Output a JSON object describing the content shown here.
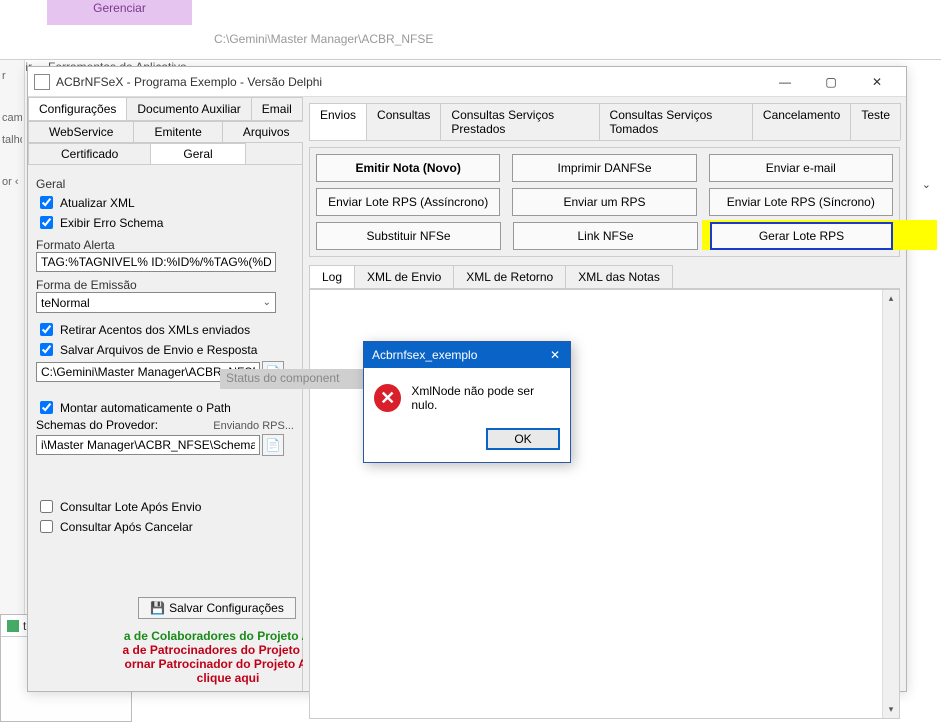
{
  "parent": {
    "tab": "Gerenciar",
    "path": "C:\\Gemini\\Master Manager\\ACBR_NFSE",
    "menu_exibir": "Exibir",
    "menu_ferr": "Ferramentas de Aplicativo"
  },
  "left_strip": {
    "i0": "r",
    "i1": "cami",
    "i2": "talho",
    "i3": "or   ‹"
  },
  "taskbar": {
    "label": "ter Manager\\AC..."
  },
  "window": {
    "title": "ACBrNFSeX - Programa Exemplo - Versão Delphi",
    "min": "—",
    "max": "▢",
    "close": "✕"
  },
  "left_tabs": {
    "t0": "Configurações",
    "t1": "Documento Auxiliar",
    "t2": "Email"
  },
  "left_sub": {
    "t0": "WebService",
    "t1": "Emitente",
    "t2": "Arquivos"
  },
  "left_sub2": {
    "t0": "Certificado",
    "t1": "Geral"
  },
  "geral": {
    "group": "Geral",
    "chk_atualizar": "Atualizar XML",
    "chk_exibir": "Exibir Erro Schema",
    "lbl_formato": "Formato Alerta",
    "formato_val": "TAG:%TAGNIVEL% ID:%ID%/%TAG%(%DESCRI",
    "lbl_emissao": "Forma de Emissão",
    "emissao_val": "teNormal",
    "chk_retirar": "Retirar Acentos dos XMLs enviados",
    "chk_salvar": "Salvar Arquivos de Envio e Resposta",
    "path_logs": "C:\\Gemini\\Master Manager\\ACBR_NFSE\\Logs",
    "chk_montar": "Montar automaticamente o Path",
    "lbl_schemas": "Schemas do Provedor:",
    "enviando": "Enviando RPS...",
    "path_schemas": "i\\Master Manager\\ACBR_NFSE\\Schemas\\NFSe",
    "chk_cons_lote": "Consultar Lote Após Envio",
    "chk_cons_canc": "Consultar Após Cancelar"
  },
  "save_btn": "Salvar Configurações",
  "links": {
    "l1": "a de Colaboradores do Projeto ACBr",
    "l2": "a de Patrocinadores do Projeto ACBr",
    "l3": "ornar Patrocinador do Projeto ACBr,",
    "l4": "clique aqui"
  },
  "rtabs": {
    "t0": "Envios",
    "t1": "Consultas",
    "t2": "Consultas Serviços Prestados",
    "t3": "Consultas Serviços Tomados",
    "t4": "Cancelamento",
    "t5": "Teste"
  },
  "buttons": {
    "r0c0": "Emitir Nota (Novo)",
    "r0c1": "Imprimir DANFSe",
    "r0c2": "Enviar e-mail",
    "r1c0": "Enviar Lote RPS (Assíncrono)",
    "r1c1": "Enviar um RPS",
    "r1c2": "Enviar Lote RPS (Síncrono)",
    "r2c0": "Substituir NFSe",
    "r2c1": "Link NFSe",
    "r2c2": "Gerar Lote RPS"
  },
  "logtabs": {
    "t0": "Log",
    "t1": "XML de Envio",
    "t2": "XML de Retorno",
    "t3": "XML das Notas"
  },
  "status_overlay": "Status do component",
  "modal": {
    "title": "Acbrnfsex_exemplo",
    "msg": "XmlNode não pode ser nulo.",
    "ok": "OK",
    "x": "✕"
  },
  "dropdown_glyph": "⌄"
}
